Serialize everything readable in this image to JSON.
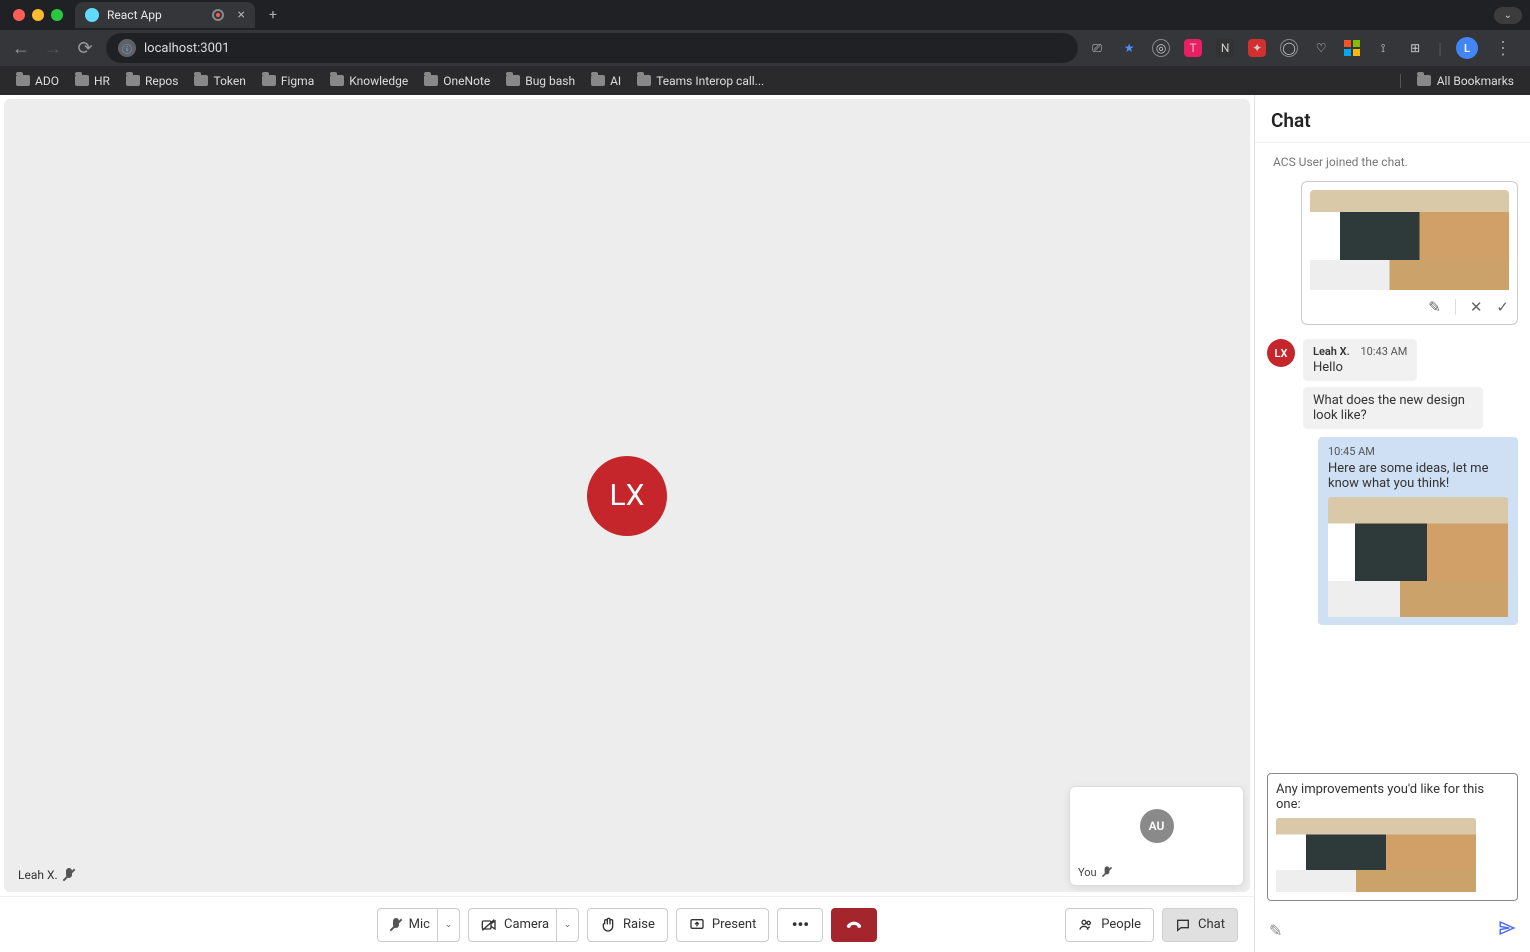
{
  "browser": {
    "tab_title": "React App",
    "url": "localhost:3001",
    "bookmarks": [
      "ADO",
      "HR",
      "Repos",
      "Token",
      "Figma",
      "Knowledge",
      "OneNote",
      "Bug bash",
      "AI",
      "Teams Interop call..."
    ],
    "all_bookmarks": "All Bookmarks",
    "profile_initial": "L"
  },
  "stage": {
    "main_participant_initials": "LX",
    "main_participant_name": "Leah X.",
    "self_initials": "AU",
    "self_label": "You"
  },
  "controls": {
    "mic": "Mic",
    "camera": "Camera",
    "raise": "Raise",
    "present": "Present",
    "people": "People",
    "chat": "Chat"
  },
  "chat": {
    "title": "Chat",
    "system_join": "ACS User joined the chat.",
    "incoming": {
      "avatar": "LX",
      "name": "Leah X.",
      "time": "10:43 AM",
      "msg1": "Hello",
      "msg2": "What does the new design look like?"
    },
    "outgoing": {
      "time": "10:45 AM",
      "text": "Here are some ideas, let me know what you think!"
    },
    "composer_text": "Any improvements you'd like for this one:"
  }
}
